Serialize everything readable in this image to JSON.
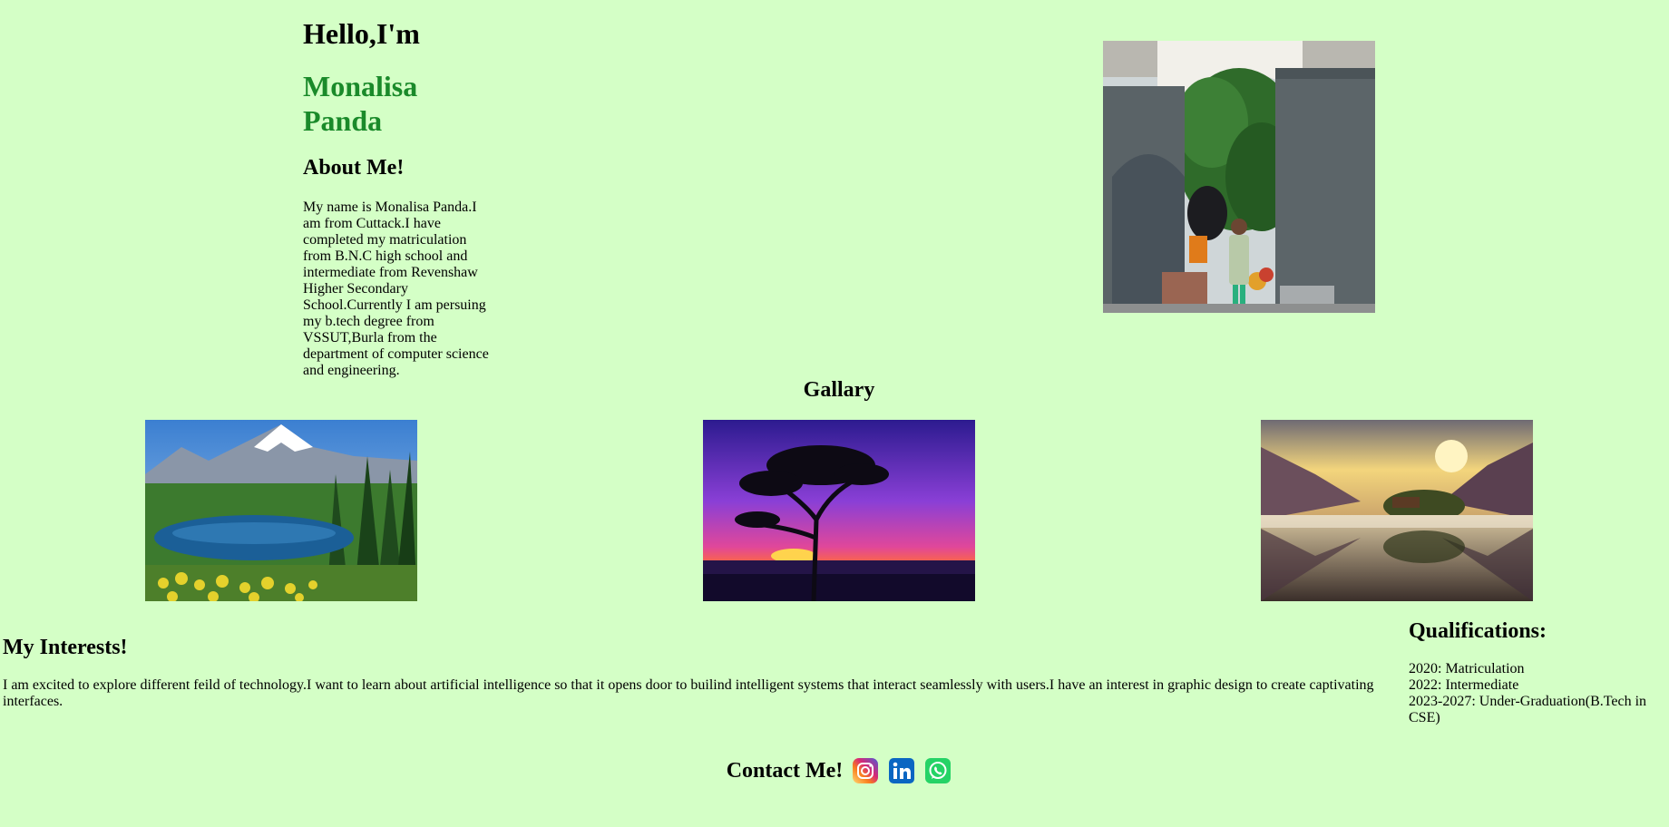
{
  "intro": {
    "greeting": "Hello,I'm",
    "name": "Monalisa Panda",
    "name_color": "#1a8a2a"
  },
  "about": {
    "heading": "About Me!",
    "text": "My name is Monalisa Panda.I am from Cuttack.I have completed my matriculation from B.N.C high school and intermediate from Revenshaw Higher Secondary School.Currently I am persuing my b.tech degree from VSSUT,Burla from the department of computer science and engineering."
  },
  "gallery": {
    "heading": "Gallary",
    "images": [
      {
        "subject": "mountain-lake"
      },
      {
        "subject": "purple-sunset-tree"
      },
      {
        "subject": "lake-reflection-sunrise"
      }
    ]
  },
  "interests": {
    "heading": "My Interests!",
    "text": "I am excited to explore different feild of technology.I want to learn about artificial intelligence so that it opens door to builind intelligent systems that interact seamlessly with users.I have an interest in graphic design to create captivating interfaces."
  },
  "qualifications": {
    "heading": "Qualifications:",
    "items": [
      "2020: Matriculation",
      "2022: Intermediate",
      "2023-2027: Under-Graduation(B.Tech in CSE)"
    ]
  },
  "contact": {
    "heading": "Contact Me!",
    "icons": [
      "instagram-icon",
      "linkedin-icon",
      "whatsapp-icon"
    ]
  },
  "colors": {
    "background": "#d4ffc6",
    "text": "#000000"
  }
}
